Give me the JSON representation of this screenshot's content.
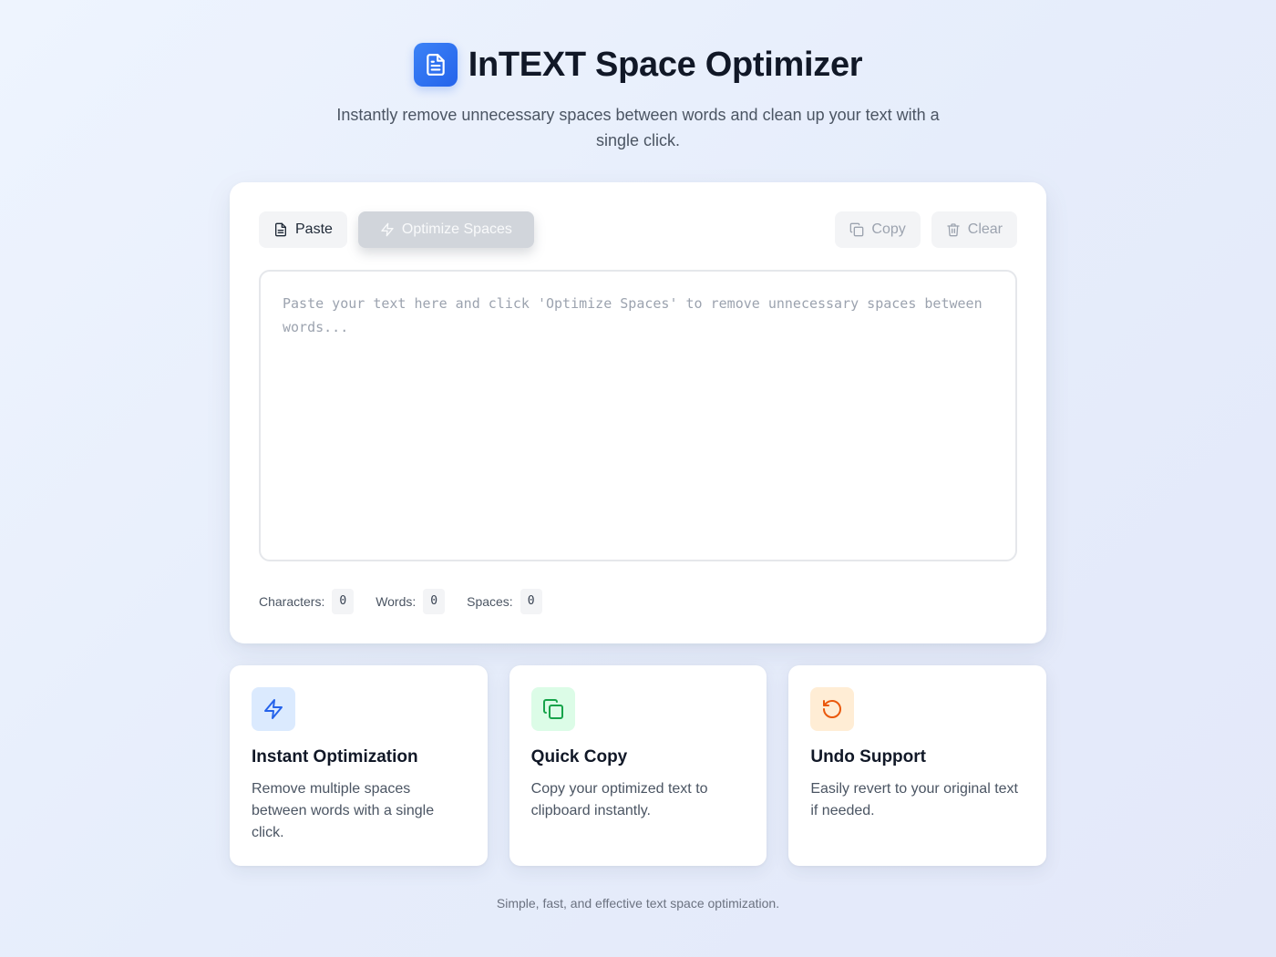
{
  "header": {
    "title": "InTEXT Space Optimizer",
    "subtitle": "Instantly remove unnecessary spaces between words and clean up your text with a single click."
  },
  "toolbar": {
    "paste_label": "Paste",
    "optimize_label": "Optimize Spaces",
    "copy_label": "Copy",
    "clear_label": "Clear"
  },
  "editor": {
    "value": "",
    "placeholder": "Paste your text here and click 'Optimize Spaces' to remove unnecessary spaces between words..."
  },
  "stats": {
    "characters_label": "Characters:",
    "characters_value": "0",
    "words_label": "Words:",
    "words_value": "0",
    "spaces_label": "Spaces:",
    "spaces_value": "0"
  },
  "features": [
    {
      "icon": "lightning-icon",
      "title": "Instant Optimization",
      "description": "Remove multiple spaces between words with a single click.",
      "accent": "#2563eb",
      "bg": "#dbeafe"
    },
    {
      "icon": "copy-icon",
      "title": "Quick Copy",
      "description": "Copy your optimized text to clipboard instantly.",
      "accent": "#16a34a",
      "bg": "#dcfce7"
    },
    {
      "icon": "undo-icon",
      "title": "Undo Support",
      "description": "Easily revert to your original text if needed.",
      "accent": "#ea580c",
      "bg": "#ffedd5"
    }
  ],
  "footer": {
    "text": "Simple, fast, and effective text space optimization."
  },
  "colors": {
    "brand": "#2563eb",
    "disabled_button": "#d1d5db",
    "secondary_button": "#f3f4f6"
  }
}
